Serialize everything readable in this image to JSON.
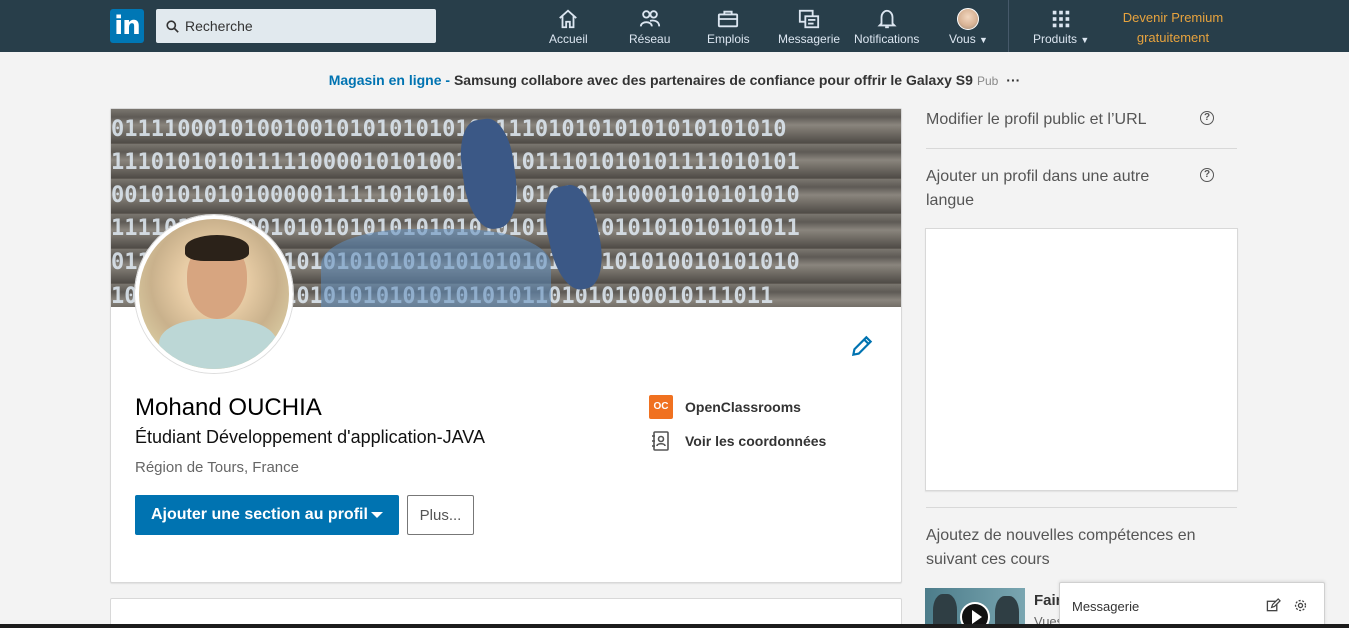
{
  "nav": {
    "logo_text": "in",
    "search_placeholder": "Recherche",
    "items": [
      {
        "label": "Accueil",
        "icon": "home-icon"
      },
      {
        "label": "Réseau",
        "icon": "network-icon"
      },
      {
        "label": "Emplois",
        "icon": "jobs-icon"
      },
      {
        "label": "Messagerie",
        "icon": "messaging-icon"
      },
      {
        "label": "Notifications",
        "icon": "bell-icon"
      },
      {
        "label": "Vous",
        "icon": "avatar"
      },
      {
        "label": "Produits",
        "icon": "grid-icon"
      }
    ],
    "premium_line1": "Devenir Premium",
    "premium_line2": "gratuitement"
  },
  "ad": {
    "store": "Magasin en ligne",
    "separator": " - ",
    "text": "Samsung collabore avec des partenaires de confiance pour offrir le Galaxy S9",
    "pub": "Pub",
    "more": "···"
  },
  "profile": {
    "name": "Mohand OUCHIA",
    "headline": "Étudiant Développement d'application-JAVA",
    "location": "Région de Tours, France",
    "add_section_label": "Ajouter une section au profil",
    "more_label": "Plus...",
    "org_logo_text": "OC",
    "org_name": "OpenClassrooms",
    "contact_label": "Voir les coordonnées",
    "banner_rows": [
      "011110001010010010101010101011110101010101010101010",
      "1110101010111110000101010010101011101010101111010101",
      "0010101010100000111110101010001010001010001010101010",
      "1111010101001010101010101010101010101010101010101011",
      "0111010101010101010101010101010101010101010010101010",
      "10110101010101010101010101010101101010100010111011"
    ]
  },
  "rail": {
    "edit_public_profile": "Modifier le profil public et l’URL",
    "add_language_profile": "Ajouter un profil dans une autre langue",
    "courses_heading": "Ajoutez de nouvelles compétences en suivant ces cours",
    "course_title": "Fair",
    "course_sub": "Vues"
  },
  "messaging": {
    "label": "Messagerie"
  },
  "colors": {
    "nav_bg": "#283e4a",
    "brand_blue": "#0073b1",
    "premium_gold": "#e7a33e",
    "oc_orange": "#f07120"
  }
}
